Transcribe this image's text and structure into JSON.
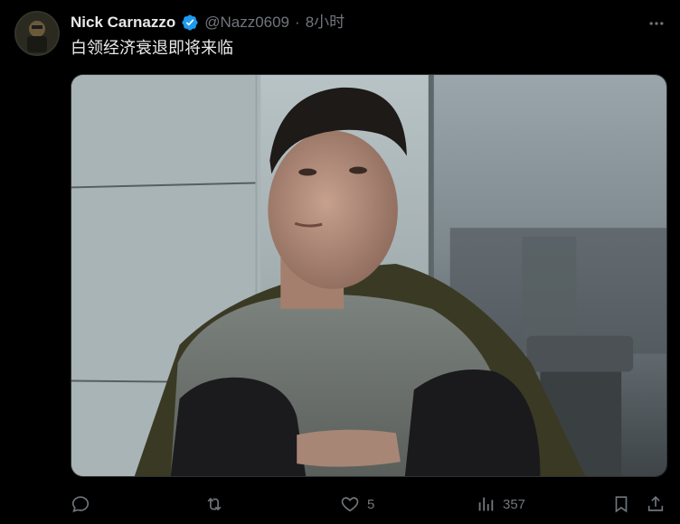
{
  "tweet": {
    "author": {
      "display_name": "Nick Carnazzo",
      "handle": "@Nazz0609",
      "verified": true
    },
    "separator": "·",
    "time": "8小时",
    "text": "白领经济衰退即将来临",
    "media_description_icon": "photo",
    "actions": {
      "reply_count": "",
      "retweet_count": "",
      "like_count": "5",
      "views_count": "357"
    }
  },
  "colors": {
    "background": "#000000",
    "primary_text": "#e7e9ea",
    "secondary_text": "#71767b",
    "verified_blue": "#1d9bf0",
    "border": "#2f3336"
  },
  "icons": {
    "more": "more-horizontal-icon",
    "reply": "reply-icon",
    "retweet": "retweet-icon",
    "like": "heart-icon",
    "views": "views-chart-icon",
    "bookmark": "bookmark-icon",
    "share": "share-icon",
    "verified": "verified-badge-icon"
  }
}
